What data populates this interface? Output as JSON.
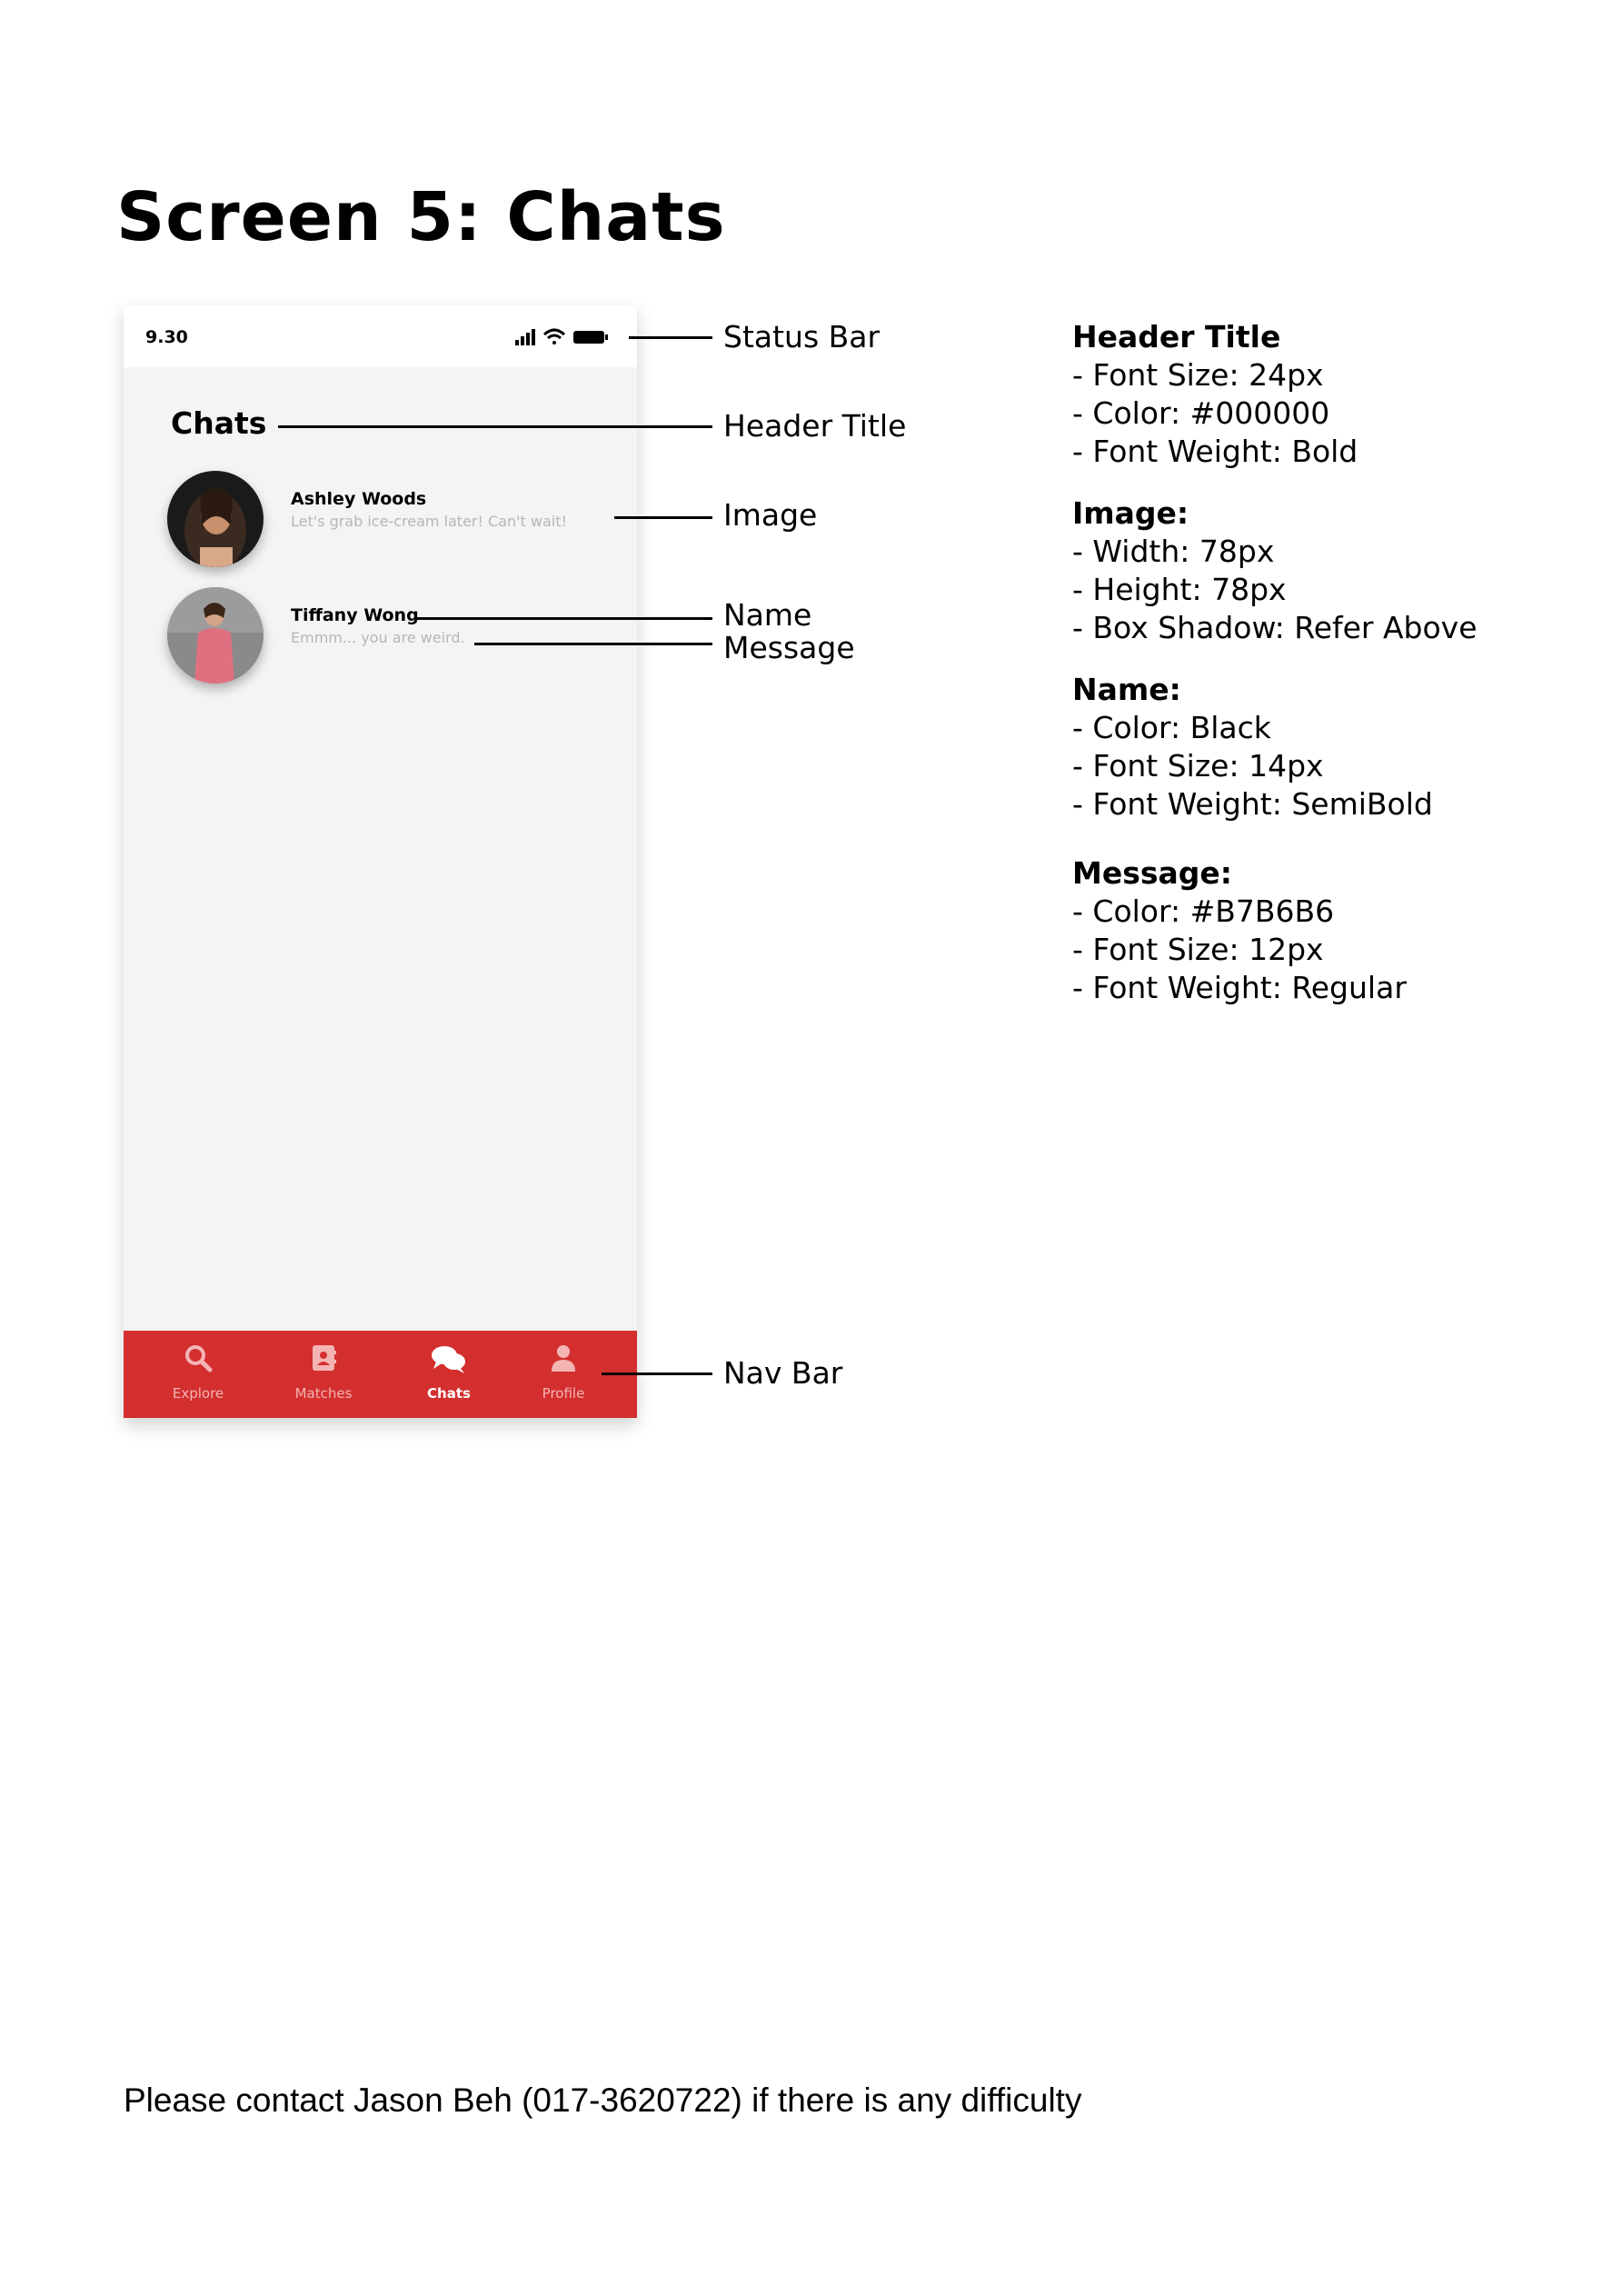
{
  "page": {
    "title": "Screen 5: Chats",
    "footer": "Please contact Jason Beh (017-3620722) if there is any difficulty"
  },
  "phone": {
    "status_time": "9.30",
    "header_title": "Chats",
    "chats": [
      {
        "name": "Ashley Woods",
        "message": "Let's grab ice-cream later! Can't wait!"
      },
      {
        "name": "Tiffany Wong",
        "message": "Emmm... you are weird."
      }
    ],
    "nav": [
      {
        "label": "Explore",
        "icon": "search-icon",
        "active": false
      },
      {
        "label": "Matches",
        "icon": "contact-book-icon",
        "active": false
      },
      {
        "label": "Chats",
        "icon": "chat-bubbles-icon",
        "active": true
      },
      {
        "label": "Profile",
        "icon": "user-icon",
        "active": false
      }
    ],
    "colors": {
      "nav_bg": "#d32f2f",
      "screen_bg": "#f4f4f4",
      "message": "#b7b6b6"
    }
  },
  "annotations": {
    "status_bar": "Status Bar",
    "header_title": "Header Title",
    "image": "Image",
    "name": "Name",
    "message": "Message",
    "nav_bar": "Nav Bar"
  },
  "specs": {
    "header_title": {
      "heading": "Header Title",
      "lines": [
        "- Font Size: 24px",
        "- Color: #000000",
        "- Font Weight: Bold"
      ]
    },
    "image": {
      "heading": "Image:",
      "lines": [
        "- Width: 78px",
        "- Height: 78px",
        "- Box Shadow: Refer Above"
      ]
    },
    "name": {
      "heading": "Name:",
      "lines": [
        "- Color: Black",
        "- Font Size: 14px",
        "- Font Weight: SemiBold"
      ]
    },
    "message": {
      "heading": "Message:",
      "lines": [
        "- Color: #B7B6B6",
        "- Font Size: 12px",
        "- Font Weight: Regular"
      ]
    }
  }
}
